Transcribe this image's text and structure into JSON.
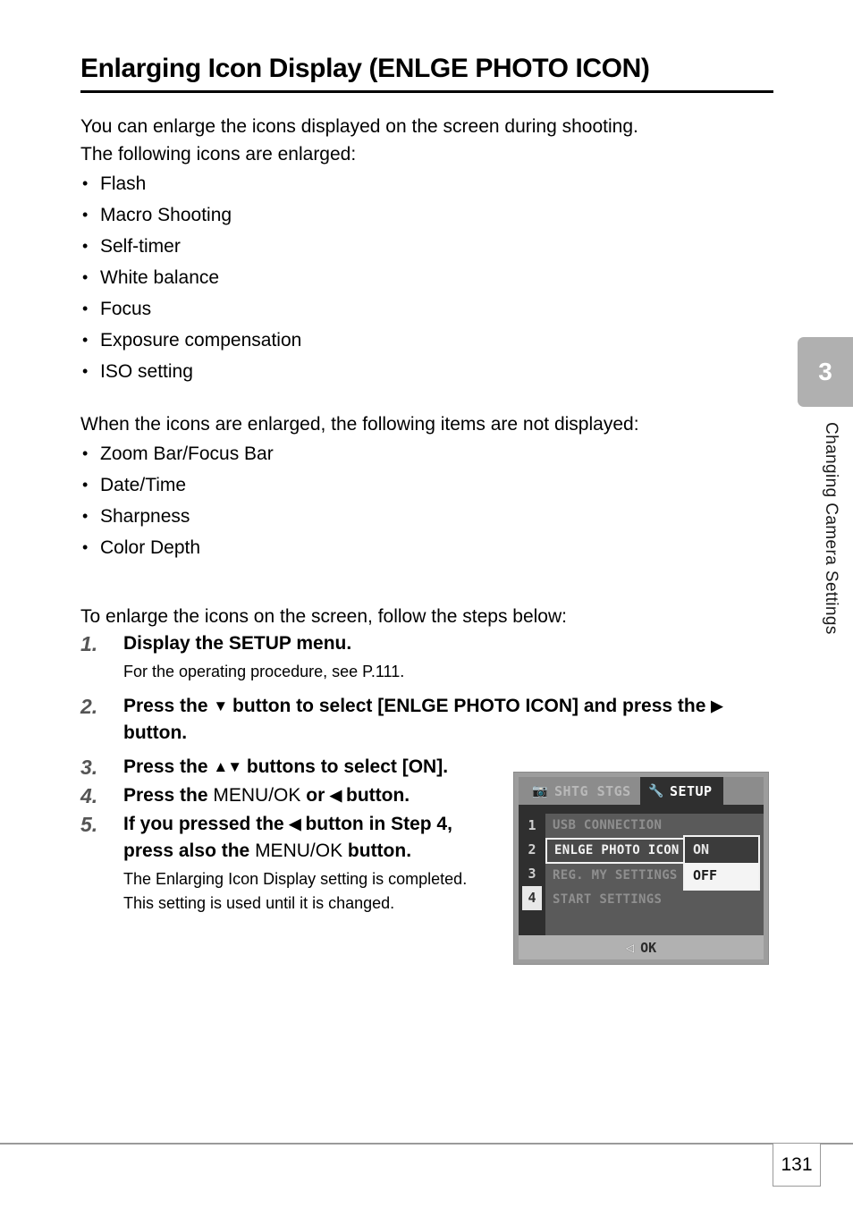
{
  "header": {
    "title": "Enlarging Icon Display (ENLGE PHOTO ICON)"
  },
  "intro": {
    "line1": "You can enlarge the icons displayed on the screen during shooting.",
    "line2": "The following icons are enlarged:"
  },
  "enlarged_items": [
    "Flash",
    "Macro Shooting",
    "Self-timer",
    "White balance",
    "Focus",
    "Exposure compensation",
    "ISO setting"
  ],
  "not_displayed_intro": "When the icons are enlarged, the following items are not displayed:",
  "not_displayed_items": [
    "Zoom Bar/Focus Bar",
    "Date/Time",
    "Sharpness",
    "Color Depth"
  ],
  "steps_intro": "To enlarge the icons on the screen, follow the steps below:",
  "steps": [
    {
      "num": "1.",
      "head": "Display the SETUP menu.",
      "sub": "For the operating procedure, see P.111."
    },
    {
      "num": "2.",
      "head_a": "Press the ",
      "arrow_a": "▼",
      "head_b": " button to select [ENLGE PHOTO ICON] and press the ",
      "arrow_b": "▶",
      "head_c": " button."
    },
    {
      "num": "3.",
      "head_a": "Press the ",
      "arrow_a": "▲▼",
      "head_b": " buttons to select [ON]."
    },
    {
      "num": "4.",
      "head_a": "Press the ",
      "plain": "MENU/OK",
      "head_b": " or ",
      "arrow_a": "◀",
      "head_c": " button."
    },
    {
      "num": "5.",
      "head_a": "If you pressed the ",
      "arrow_a": "◀",
      "head_b": " button in Step 4, press also the ",
      "plain": "MENU/OK",
      "head_c": " button.",
      "sub1": "The Enlarging Icon Display setting is completed.",
      "sub2": "This setting is used until it is changed."
    }
  ],
  "lcd": {
    "tab_shooting": "SHTG STGS",
    "tab_shooting_icon": "camera-icon",
    "tab_setup": "SETUP",
    "tab_setup_icon": "wrench-screwdriver-icon",
    "row_numbers": [
      "1",
      "2",
      "3",
      "4"
    ],
    "active_row": "4",
    "menu_items": [
      "USB CONNECTION",
      "ENLGE PHOTO ICON",
      "REG. MY SETTINGS",
      "START SETTINGS"
    ],
    "selected_item": "ENLGE PHOTO ICON",
    "caret": "◀",
    "dropdown_options": [
      "ON",
      "OFF"
    ],
    "dropdown_current": "ON",
    "dropdown_highlighted": "OFF",
    "footer_arrow": "◁",
    "footer_label": "OK"
  },
  "chapter": {
    "number": "3",
    "label": "Changing Camera Settings"
  },
  "footer": {
    "page_number": "131"
  },
  "colors": {
    "chapter_tab": "#b0b0b0",
    "rule": "#9a9a9a",
    "step_number": "#555555",
    "lcd_dark": "#2f2f2f",
    "lcd_mid": "#5a5a5a",
    "lcd_light": "#b1b1b1"
  }
}
